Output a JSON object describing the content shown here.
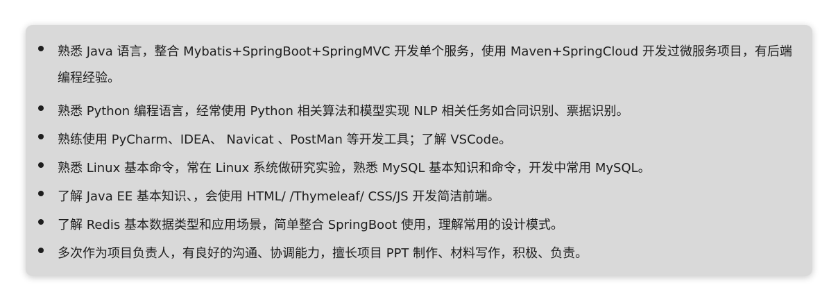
{
  "skills": [
    "熟悉 Java 语言，整合 Mybatis+SpringBoot+SpringMVC 开发单个服务，使用 Maven+SpringCloud 开发过微服务项目，有后端编程经验。",
    "熟悉 Python 编程语言，经常使用 Python 相关算法和模型实现 NLP 相关任务如合同识别、票据识别。",
    "熟练使用 PyCharm、IDEA、 Navicat 、PostMan 等开发工具；了解 VSCode。",
    "熟悉 Linux 基本命令，常在 Linux 系统做研究实验，熟悉 MySQL 基本知识和命令，开发中常用 MySQL。",
    "了解 Java EE 基本知识、，会使用 HTML/ /Thymeleaf/ CSS/JS 开发简洁前端。",
    "了解 Redis 基本数据类型和应用场景，简单整合 SpringBoot 使用，理解常用的设计模式。",
    "多次作为项目负责人，有良好的沟通、协调能力，擅长项目 PPT 制作、材料写作，积极、负责。"
  ]
}
